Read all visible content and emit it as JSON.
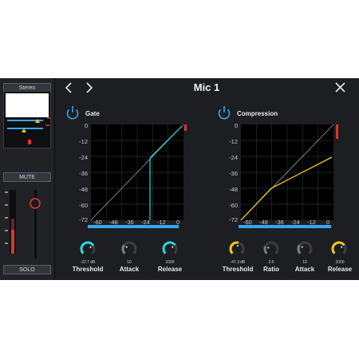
{
  "window": {
    "title": "Mic 1"
  },
  "strip": {
    "output_label": "Stereo",
    "mute_label": "MUTE",
    "solo_label": "SOLO"
  },
  "gate": {
    "label": "Gate",
    "threshold_value": "-22.7 dB",
    "attack_value": "10",
    "release_value": "1000",
    "threshold_label": "Threshold",
    "attack_label": "Attack",
    "release_label": "Release",
    "accent_color": "#2ad4e0",
    "knob_levels": {
      "threshold": 0.72,
      "attack": 0.3,
      "release": 0.7
    }
  },
  "compression": {
    "label": "Compression",
    "threshold_value": "-47.3",
    "threshold_unit": "dB",
    "ratio_value": "2.0",
    "attack_value": "10",
    "release_value": "1000",
    "threshold_label": "Threshold",
    "ratio_label": "Ratio",
    "attack_label": "Attack",
    "release_label": "Release",
    "accent_color": "#f5c518",
    "knob_levels": {
      "threshold": 0.55,
      "ratio": 0.25,
      "attack": 0.3,
      "release": 0.7
    }
  },
  "graph_ticks": {
    "y": [
      "0",
      "-12",
      "-24",
      "-36",
      "-48",
      "-60",
      "-72"
    ],
    "x": [
      "-72",
      "-60",
      "-48",
      "-36",
      "-24",
      "-12",
      "0"
    ]
  },
  "colors": {
    "power_icon": "#37a7f0",
    "meter_blue": "#37a7f0",
    "meter_red": "#e0342c"
  }
}
